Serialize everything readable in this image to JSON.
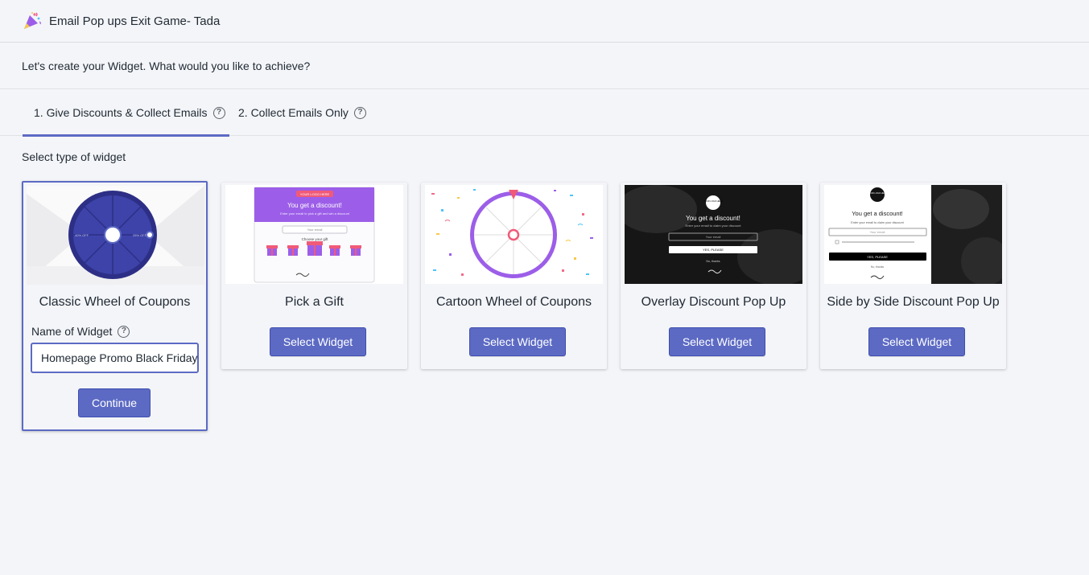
{
  "app": {
    "title": "Email Pop ups Exit Game- Tada",
    "icon": "party-popper-icon"
  },
  "subtitle": "Let's create your Widget. What would you like to achieve?",
  "tabs": [
    {
      "label": "1. Give Discounts & Collect Emails",
      "active": true
    },
    {
      "label": "2. Collect Emails Only",
      "active": false
    }
  ],
  "section_label": "Select type of widget",
  "widgets": [
    {
      "title": "Classic Wheel of Coupons",
      "field_label": "Name of Widget",
      "input_value": "Homepage Promo Black Friday",
      "continue_label": "Continue"
    },
    {
      "title": "Pick a Gift",
      "button": "Select Widget",
      "preview": {
        "logo": "YOUR LOGO HERE",
        "heading": "You get a discount!",
        "sub": "Enter your email to pick a gift and win a discount",
        "email": "Your email",
        "choose": "Choose your gift"
      }
    },
    {
      "title": "Cartoon Wheel of Coupons",
      "button": "Select Widget"
    },
    {
      "title": "Overlay Discount Pop Up",
      "button": "Select Widget",
      "preview": {
        "logo": "YOUR LOGO HERE",
        "heading": "You get a discount!",
        "sub": "Enter your email to claim your discount",
        "email": "Your email",
        "cta": "YES, PLEASE",
        "no": "No, thanks"
      }
    },
    {
      "title": "Side by Side Discount Pop Up",
      "button": "Select Widget",
      "preview": {
        "logo": "YOUR LOGO HERE",
        "heading": "You get a discount!",
        "sub": "Enter your email to claim your discount",
        "email": "Your email",
        "cta": "YES, PLEASE",
        "no": "No, thanks"
      }
    }
  ],
  "colors": {
    "accent": "#5c6ac4",
    "wheel": "#3a3f9e",
    "purple": "#9c5ee8"
  }
}
